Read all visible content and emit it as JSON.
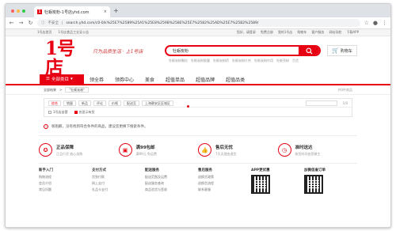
{
  "browser": {
    "tab_title": "牡蛎炭粉-1号店yhd.com",
    "tab_close": "×",
    "new_tab": "+",
    "security": "不安全",
    "url": "search.yhd.com/c0-0/k%25E7%2589%25A1%25E8%259B%258E%25E7%2582%25AD%25E7%25B2%2589/",
    "colors": {
      "red": "#fc605c",
      "yellow": "#fdbc40",
      "green": "#34c84a"
    }
  },
  "topbar": {
    "left": [
      "1号店首页",
      "1号店食品工业证公告"
    ],
    "right": [
      "您好，请登录",
      "免费注册",
      "我的1号店",
      "购物车",
      "客户服务",
      "网站导航",
      "下载APP"
    ]
  },
  "header": {
    "logo_text": "1号店",
    "logo_sub": "YHD.COM",
    "slogan": "只为品质生活 · 上1号店",
    "search_value": "牡蛎炭粉",
    "hot_keywords": [
      "牡蛎炭粉颗粒",
      "牡蛎炭粉胶囊",
      "牡蛎炭粉药",
      "牡蛎炭粉片剂",
      "牡蛎炭粉作用",
      "牡蛎壳粉",
      "百货"
    ],
    "cart_label": "购物车"
  },
  "menu": {
    "all_categories": "全部类目",
    "items": [
      "领全券",
      "领券中心",
      "美食",
      "超值单品",
      "超值品牌",
      "超值品类"
    ]
  },
  "crumb": {
    "all": "全部结果",
    "arrow": ">",
    "query": "\"牡蛎炭粉\"",
    "result": "共0件商品"
  },
  "filter": {
    "sorts": [
      "综合",
      "销量",
      "新品",
      "评论",
      "价格",
      "配送至",
      "上海静安区区域区"
    ],
    "price_label": "价格区间",
    "page": "1/0",
    "options": [
      "1号店自营",
      "仅显示有货"
    ]
  },
  "notice": "很抱歉，没有找到符合条件的商品，建议您更换下搜索条件。",
  "guarantees": [
    {
      "icon": "ribbon-icon",
      "title": "正品保障",
      "sub": "正品行货 放心选购"
    },
    {
      "icon": "truck-icon",
      "title": "满99包邮",
      "sub": "满99元 免运费"
    },
    {
      "icon": "thumbs-up-icon",
      "title": "售后无忧",
      "sub": "7天无理由退货"
    },
    {
      "icon": "clock-icon",
      "title": "准时送达",
      "sub": "收货时间由您做主"
    }
  ],
  "footer": [
    {
      "title": "新手入门",
      "links": [
        "购物流程",
        "会员介绍",
        "常见问题"
      ]
    },
    {
      "title": "支付方式",
      "links": [
        "货到付款",
        "网上支付",
        "礼品卡支付"
      ]
    },
    {
      "title": "配送服务",
      "links": [
        "配送范围及运费",
        "配送服务查询",
        "商品验货与签收"
      ]
    },
    {
      "title": "售后服务",
      "links": [
        "退换货政策",
        "退换货流程",
        "联系客服"
      ]
    },
    {
      "title": "APP更优惠",
      "links": []
    },
    {
      "title": "加微信查订单",
      "links": []
    }
  ]
}
